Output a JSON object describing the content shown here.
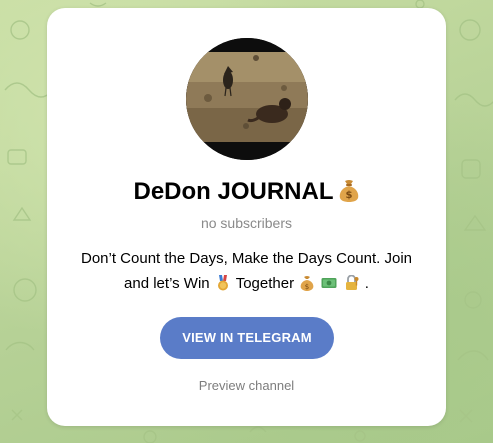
{
  "channel": {
    "title": "DeDon JOURNAL",
    "title_emoji": "money-bag-icon",
    "subscribers": "no subscribers",
    "description_parts": [
      "Don’t Count the Days, Make the Days Count. Join and let’s Win",
      "Together",
      "."
    ],
    "description_emojis": [
      "medal-icon",
      "money-bag-icon",
      "dollar-banknote-icon",
      "locked-with-key-icon"
    ]
  },
  "actions": {
    "view_label": "VIEW IN TELEGRAM",
    "preview_label": "Preview channel"
  },
  "colors": {
    "background": "#b9d39a",
    "button": "#5a7cc8",
    "muted_text": "#8a8a8a"
  }
}
